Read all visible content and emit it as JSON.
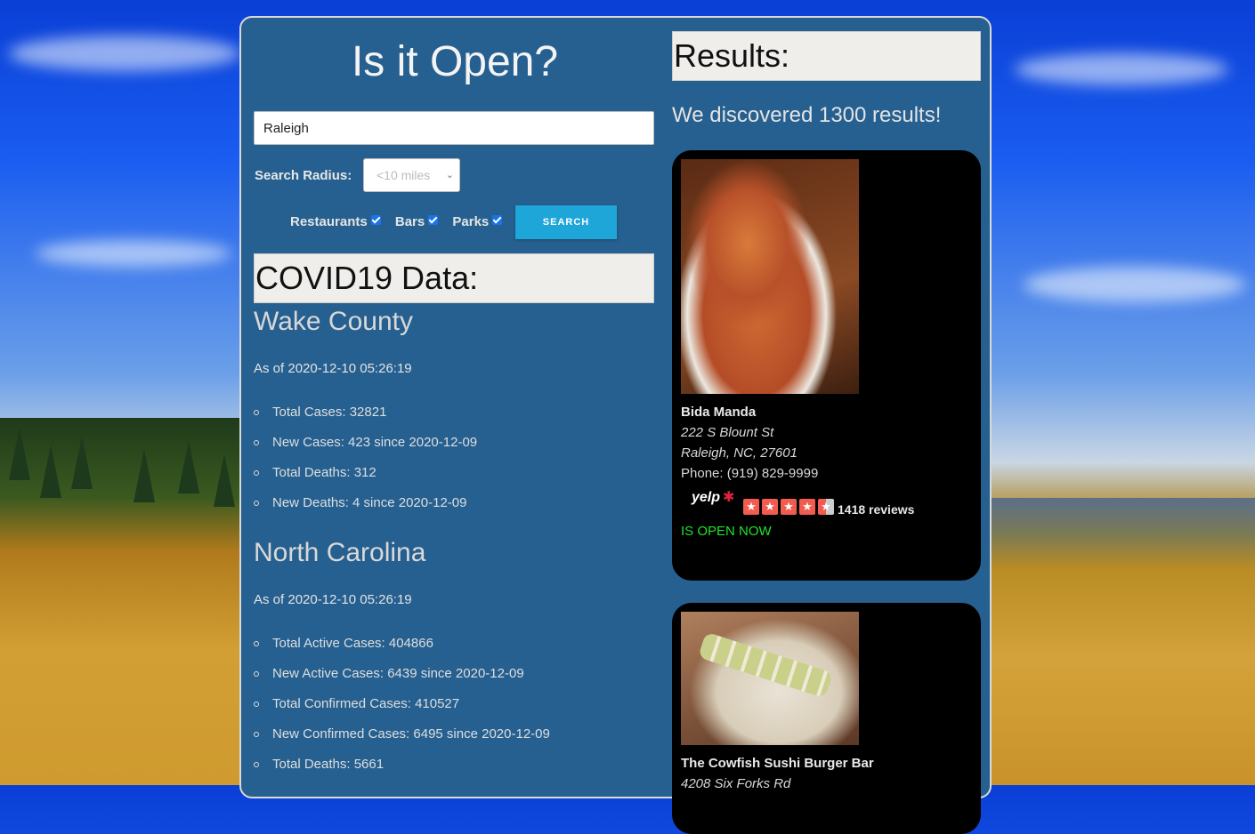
{
  "header": {
    "title": "Is it Open?"
  },
  "search": {
    "value": "Raleigh"
  },
  "radius": {
    "label": "Search Radius:",
    "selected": "<10 miles"
  },
  "filters": [
    {
      "label": "Restaurants",
      "checked": true
    },
    {
      "label": "Bars",
      "checked": true
    },
    {
      "label": "Parks",
      "checked": true
    }
  ],
  "search_button": {
    "label": "SEARCH"
  },
  "covid": {
    "heading": "COVID19 Data:",
    "county": {
      "name": "Wake County",
      "as_of": "As of 2020-12-10 05:26:19",
      "stats": [
        "Total Cases: 32821",
        "New Cases: 423 since 2020-12-09",
        "Total Deaths: 312",
        "New Deaths: 4 since 2020-12-09"
      ]
    },
    "state": {
      "name": "North Carolina",
      "as_of": "As of 2020-12-10 05:26:19",
      "stats": [
        "Total Active Cases: 404866",
        "New Active Cases: 6439 since 2020-12-09",
        "Total Confirmed Cases: 410527",
        "New Confirmed Cases: 6495 since 2020-12-09",
        "Total Deaths: 5661"
      ]
    }
  },
  "results": {
    "heading": "Results:",
    "summary": "We discovered 1300 results!",
    "items": [
      {
        "name": "Bida Manda",
        "street": "222 S Blount St",
        "city": "Raleigh, NC, 27601",
        "phone": "Phone: (919) 829-9999",
        "yelp_logo": "yelp",
        "rating": 4.5,
        "reviews": "1418 reviews",
        "status": "IS OPEN NOW",
        "status_color": "#22e32a"
      },
      {
        "name": "The Cowfish Sushi Burger Bar",
        "street": "4208 Six Forks Rd"
      }
    ]
  },
  "colors": {
    "panel": "#266090",
    "accent": "#1ea6d9",
    "open": "#22e32a"
  }
}
